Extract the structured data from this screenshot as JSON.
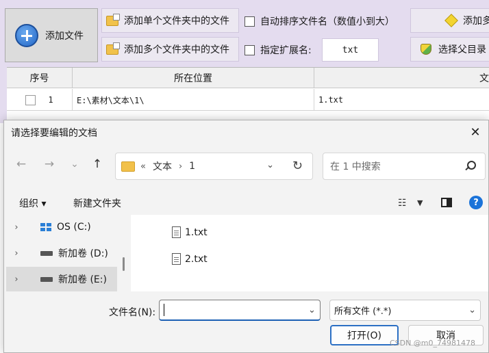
{
  "app": {
    "add_file_label": "添加文件",
    "add_single_folder_label": "添加单个文件夹中的文件",
    "add_multi_folder_label": "添加多个文件夹中的文件",
    "auto_sort_label": "自动排序文件名（数值小到大）",
    "ext_label": "指定扩展名:",
    "ext_value": "txt",
    "add_more_label": "添加多",
    "choose_parent_label": "选择父目录",
    "grid_headers": [
      "序号",
      "所在位置",
      "文"
    ],
    "rows": [
      {
        "index": "1",
        "location": "E:\\素材\\文本\\1\\",
        "name": "1.txt"
      }
    ]
  },
  "dialog": {
    "title": "请选择要编辑的文档",
    "close_glyph": "✕",
    "nav": {
      "back": "←",
      "forward": "→",
      "recent": "⌄",
      "up": "↑"
    },
    "address": {
      "prefix": "«",
      "segments": [
        "文本",
        "1"
      ],
      "dropdown": "⌄",
      "refresh": "↻"
    },
    "search_placeholder": "在 1 中搜索",
    "commands": {
      "organize": "组织 ▾",
      "new_folder": "新建文件夹",
      "view": "☷",
      "view_dropdown": "▼",
      "help": "?"
    },
    "tree": [
      {
        "label": "OS (C:)",
        "icon": "windows-drive-icon",
        "selected": false
      },
      {
        "label": "新加卷 (D:)",
        "icon": "drive-icon",
        "selected": false
      },
      {
        "label": "新加卷 (E:)",
        "icon": "drive-icon",
        "selected": true
      }
    ],
    "files": [
      "1.txt",
      "2.txt"
    ],
    "filename_label": "文件名(N):",
    "filename_value": "",
    "filter_value": "所有文件 (*.*)",
    "open_label": "打开(O)",
    "cancel_label": "取消"
  },
  "watermark": "CSDN @m0_74981478"
}
